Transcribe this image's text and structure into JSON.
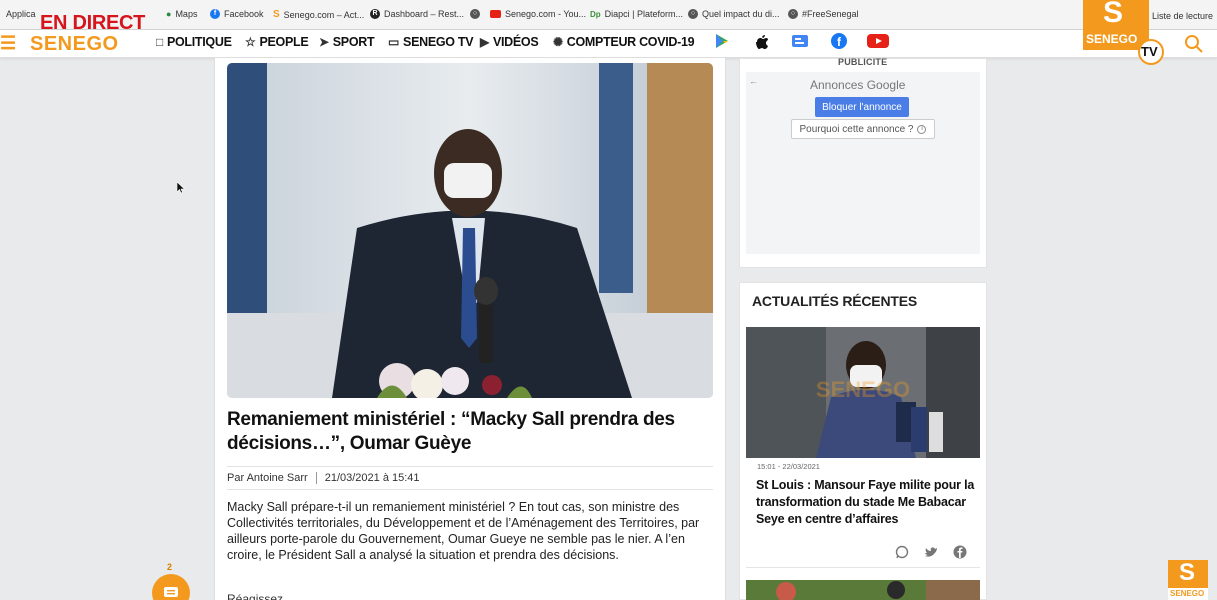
{
  "bookmarks": {
    "items": [
      {
        "label": "Applica",
        "icon": "apps-icon"
      },
      {
        "label": "Maps",
        "icon": "map-pin-icon"
      },
      {
        "label": "Facebook",
        "icon": "facebook-icon"
      },
      {
        "label": "Senego.com – Act...",
        "icon": "senego-icon"
      },
      {
        "label": "Dashboard – Rest...",
        "icon": "dashboard-icon"
      },
      {
        "label": "",
        "icon": "globe-icon"
      },
      {
        "label": "Senego.com - You...",
        "icon": "youtube-icon"
      },
      {
        "label": "Diapci | Plateform...",
        "icon": "diapci-icon"
      },
      {
        "label": "Quel impact du di...",
        "icon": "globe-icon"
      },
      {
        "label": "#FreeSenegal",
        "icon": "globe-icon"
      }
    ],
    "reading_list": "Liste de lecture"
  },
  "live_banner": "EN DIRECT",
  "logo": "SENEGO",
  "nav": {
    "items": [
      {
        "label": "POLITIQUE",
        "icon": "document-icon"
      },
      {
        "label": "PEOPLE",
        "icon": "star-icon"
      },
      {
        "label": "SPORT",
        "icon": "runner-icon"
      },
      {
        "label": "SENEGO TV",
        "icon": "monitor-icon"
      },
      {
        "label": "VIDÉOS",
        "icon": "video-icon"
      },
      {
        "label": "COMPTEUR COVID-19",
        "icon": "virus-icon"
      }
    ]
  },
  "tv_logo": {
    "letter": "S",
    "name": "SENEGO",
    "tv": "TV"
  },
  "article": {
    "headline": "Remaniement ministériel : “Macky Sall prendra des décisions…”, Oumar Guèye",
    "author": "Par Antoine Sarr",
    "date": "21/03/2021 à 15:41",
    "lead": "Macky Sall prépare-t-il un remaniement ministériel ? En tout cas, son ministre des Collectivités territoriales, du Développement et de l’Aménagement des Territoires, par ailleurs porte-parole du Gouvernement, Oumar Gueye ne semble pas le nier. A l’en croire, le Président Sall a analysé la situation et prendra des décisions.",
    "cut_text": "Réagissez"
  },
  "ad": {
    "title": "PUBLICITE",
    "google_label": "Annonces Google",
    "block_button": "Bloquer l'annonce",
    "why_button": "Pourquoi cette annonce ?"
  },
  "recent": {
    "title": "ACTUALITÉS RÉCENTES",
    "items": [
      {
        "date": "15:01 - 22/03/2021",
        "headline": "St Louis : Mansour Faye milite pour la transformation du stade Me Babacar Seye en centre d’affaires"
      }
    ]
  },
  "chat": {
    "count": "2"
  },
  "corner_logo": {
    "letter": "S",
    "name": "SENEGO"
  },
  "colors": {
    "brand": "#f39a1e",
    "live": "#d5141c",
    "ad_button": "#4a7ee6"
  }
}
